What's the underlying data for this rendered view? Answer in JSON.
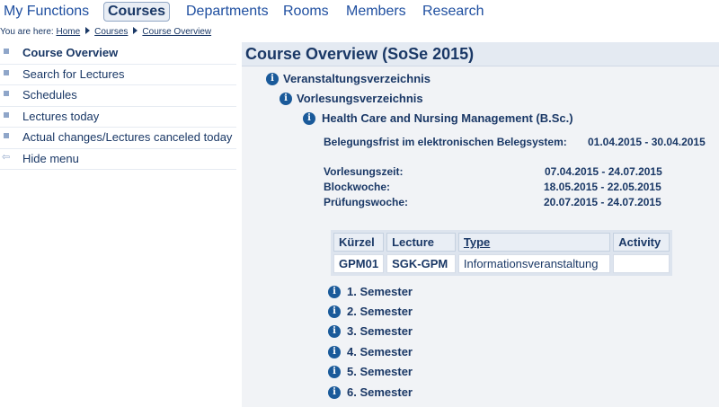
{
  "topnav": {
    "items": [
      {
        "label": "My Functions",
        "active": false
      },
      {
        "label": "Courses",
        "active": true
      },
      {
        "label": "Departments",
        "active": false
      },
      {
        "label": "Rooms",
        "active": false
      },
      {
        "label": "Members",
        "active": false
      },
      {
        "label": "Research",
        "active": false
      }
    ]
  },
  "breadcrumb": {
    "prefix": "You are here:",
    "items": [
      "Home",
      "Courses",
      "Course Overview"
    ]
  },
  "sidebar": {
    "items": [
      {
        "label": "Course Overview",
        "active": true
      },
      {
        "label": "Search for Lectures"
      },
      {
        "label": "Schedules"
      },
      {
        "label": "Lectures today"
      },
      {
        "label": "Actual changes/Lectures canceled today"
      },
      {
        "label": "Hide menu"
      }
    ]
  },
  "content": {
    "title": "Course Overview (SoSe 2015)",
    "tree": {
      "level1": "Veranstaltungsverzeichnis",
      "level2": "Vorlesungsverzeichnis",
      "level3": "Health Care and Nursing Management (B.Sc.)"
    },
    "belegungsfrist": {
      "label": "Belegungsfrist im elektronischen Belegsystem:",
      "value": "01.04.2015 - 30.04.2015"
    },
    "periods": [
      {
        "label": "Vorlesungszeit:",
        "value": "07.04.2015 - 24.07.2015"
      },
      {
        "label": "Blockwoche:",
        "value": "18.05.2015 - 22.05.2015"
      },
      {
        "label": "Prüfungswoche:",
        "value": "20.07.2015 - 24.07.2015"
      }
    ],
    "table": {
      "headers": [
        "Kürzel",
        "Lecture",
        "Type",
        "Activity"
      ],
      "rows": [
        [
          "GPM01",
          "SGK-GPM",
          "Informationsveranstaltung",
          ""
        ]
      ]
    },
    "semesters": [
      "1. Semester",
      "2. Semester",
      "3. Semester",
      "4. Semester",
      "5. Semester",
      "6. Semester"
    ],
    "info_icon": "info-icon"
  },
  "colors": {
    "text": "#1a3866",
    "link": "#1f4fa0",
    "info_icon": "#1a5a9a",
    "content_bg": "#f1f3f6"
  }
}
